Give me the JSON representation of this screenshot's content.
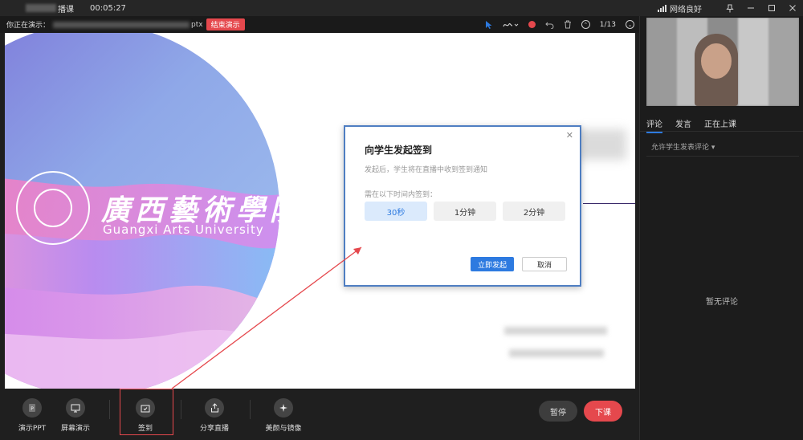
{
  "titlebar": {
    "title": "播课",
    "timer": "00:05:27",
    "network": "网络良好",
    "pin_icon": "pin-icon",
    "minimize_icon": "minimize-icon",
    "maximize_icon": "maximize-icon",
    "close_icon": "close-icon"
  },
  "presenting": {
    "label": "你正在演示：",
    "file_suffix": "ptx",
    "end_button": "结束演示",
    "page": "1/13"
  },
  "slide": {
    "university_cn": "廣西藝術學院",
    "university_en": "Guangxi Arts University"
  },
  "dialog": {
    "title": "向学生发起签到",
    "description": "发起后，学生将在直播中收到签到通知",
    "prompt": "需在以下时间内签到：",
    "options": [
      "30秒",
      "1分钟",
      "2分钟"
    ],
    "selected_option": "30秒",
    "confirm": "立即发起",
    "cancel": "取消"
  },
  "toolbar": {
    "ppt": "演示PPT",
    "screen": "屏幕演示",
    "signin": "签到",
    "share": "分享直播",
    "beauty": "美颜与镜像",
    "pause": "暂停",
    "end_class": "下课"
  },
  "rightpanel": {
    "tabs": [
      "评论",
      "发言",
      "正在上课"
    ],
    "active_tab": "评论",
    "allow_comment": "允许学生发表评论 ▾",
    "no_comment": "暂无评论"
  },
  "colors": {
    "accent": "#2d7ae0",
    "danger": "#e5484d",
    "background": "#1f1f1f"
  }
}
